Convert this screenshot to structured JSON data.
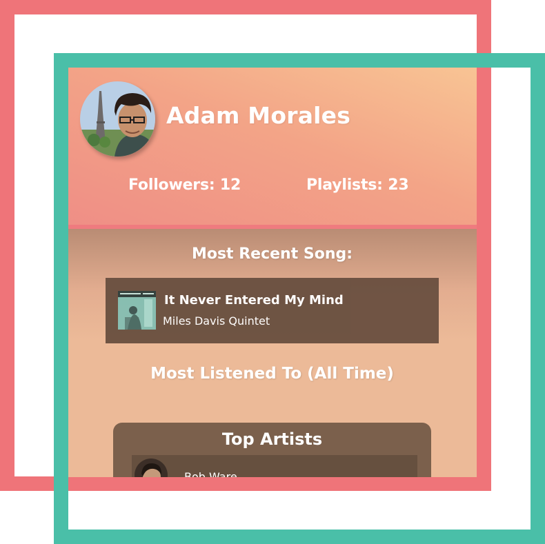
{
  "profile": {
    "name": "Adam Morales",
    "followers_label": "Followers: 12",
    "playlists_label": "Playlists: 23"
  },
  "recent": {
    "title": "Most Recent Song:",
    "song_title": "It Never Entered My Mind",
    "song_artist": "Miles Davis Quintet"
  },
  "most_listened": {
    "title": "Most Listened To (All Time)"
  },
  "top_artists": {
    "title": "Top Artists",
    "items": [
      {
        "name": "Bob Ware"
      }
    ]
  },
  "colors": {
    "frame_pink": "#ef7479",
    "frame_teal": "#4abfa8",
    "panel_dark": "#6b5141"
  },
  "icons": [
    "profile-avatar",
    "album-art",
    "artist-thumb"
  ]
}
